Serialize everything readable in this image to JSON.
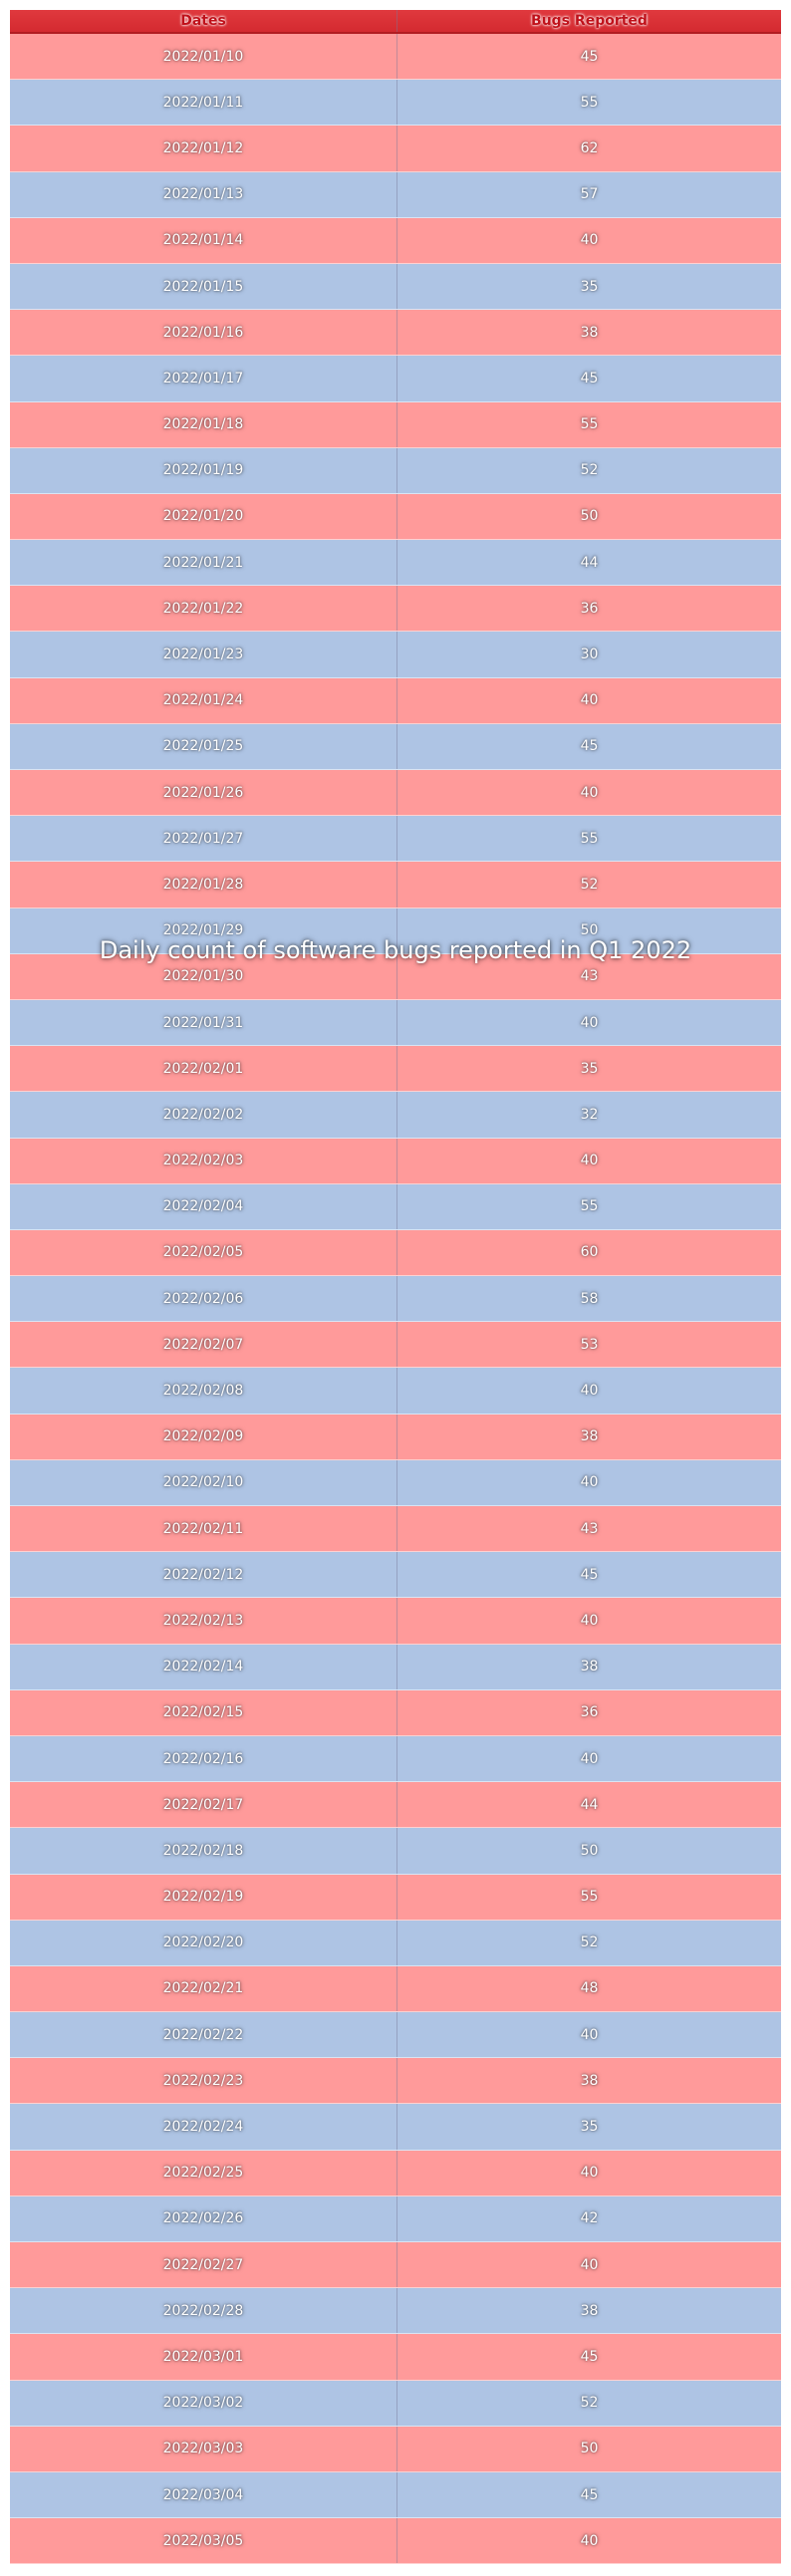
{
  "chart_data": {
    "type": "table",
    "title": "Daily count of software bugs reported in Q1 2022",
    "columns": [
      "Dates",
      "Bugs Reported"
    ],
    "rows": [
      [
        "2022/01/10",
        45
      ],
      [
        "2022/01/11",
        55
      ],
      [
        "2022/01/12",
        62
      ],
      [
        "2022/01/13",
        57
      ],
      [
        "2022/01/14",
        40
      ],
      [
        "2022/01/15",
        35
      ],
      [
        "2022/01/16",
        38
      ],
      [
        "2022/01/17",
        45
      ],
      [
        "2022/01/18",
        55
      ],
      [
        "2022/01/19",
        52
      ],
      [
        "2022/01/20",
        50
      ],
      [
        "2022/01/21",
        44
      ],
      [
        "2022/01/22",
        36
      ],
      [
        "2022/01/23",
        30
      ],
      [
        "2022/01/24",
        40
      ],
      [
        "2022/01/25",
        45
      ],
      [
        "2022/01/26",
        40
      ],
      [
        "2022/01/27",
        55
      ],
      [
        "2022/01/28",
        52
      ],
      [
        "2022/01/29",
        50
      ],
      [
        "2022/01/30",
        43
      ],
      [
        "2022/01/31",
        40
      ],
      [
        "2022/02/01",
        35
      ],
      [
        "2022/02/02",
        32
      ],
      [
        "2022/02/03",
        40
      ],
      [
        "2022/02/04",
        55
      ],
      [
        "2022/02/05",
        60
      ],
      [
        "2022/02/06",
        58
      ],
      [
        "2022/02/07",
        53
      ],
      [
        "2022/02/08",
        40
      ],
      [
        "2022/02/09",
        38
      ],
      [
        "2022/02/10",
        40
      ],
      [
        "2022/02/11",
        43
      ],
      [
        "2022/02/12",
        45
      ],
      [
        "2022/02/13",
        40
      ],
      [
        "2022/02/14",
        38
      ],
      [
        "2022/02/15",
        36
      ],
      [
        "2022/02/16",
        40
      ],
      [
        "2022/02/17",
        44
      ],
      [
        "2022/02/18",
        50
      ],
      [
        "2022/02/19",
        55
      ],
      [
        "2022/02/20",
        52
      ],
      [
        "2022/02/21",
        48
      ],
      [
        "2022/02/22",
        40
      ],
      [
        "2022/02/23",
        38
      ],
      [
        "2022/02/24",
        35
      ],
      [
        "2022/02/25",
        40
      ],
      [
        "2022/02/26",
        42
      ],
      [
        "2022/02/27",
        40
      ],
      [
        "2022/02/28",
        38
      ],
      [
        "2022/03/01",
        45
      ],
      [
        "2022/03/02",
        52
      ],
      [
        "2022/03/03",
        50
      ],
      [
        "2022/03/04",
        45
      ],
      [
        "2022/03/05",
        40
      ]
    ]
  },
  "colors": {
    "header": "#d42a30",
    "header_text": "#c0111a",
    "row_odd": "#ff9a9a",
    "row_even": "#aec4e4"
  }
}
